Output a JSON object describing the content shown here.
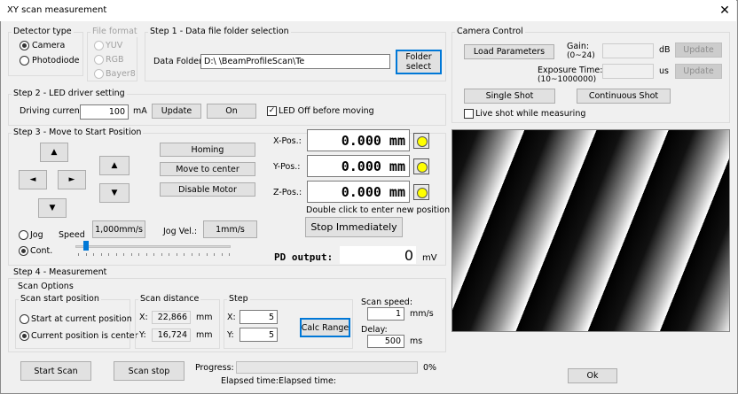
{
  "window": {
    "title": "XY scan measurement",
    "close": "✕"
  },
  "detector": {
    "label": "Detector type",
    "camera": "Camera",
    "photodiode": "Photodiode"
  },
  "file_format": {
    "label": "File format",
    "yuv": "YUV",
    "rgb": "RGB",
    "bayer8": "Bayer8"
  },
  "step1": {
    "label": "Step 1 - Data file folder selection",
    "folder_label": "Data Folder:",
    "folder_value": "D:\\                                 \\BeamProfileScan\\Te",
    "folder_select_1": "Folder",
    "folder_select_2": "select"
  },
  "camera": {
    "label": "Camera Control",
    "load_params": "Load Parameters",
    "gain_label": "Gain:",
    "gain_range": "(0~24)",
    "gain_unit": "dB",
    "update1": "Update",
    "exposure_label": "Exposure Time:",
    "exposure_range": "(10~1000000)",
    "exposure_unit": "us",
    "update2": "Update",
    "single_shot": "Single Shot",
    "continuous_shot": "Continuous Shot",
    "live_shot": "Live shot while measuring"
  },
  "step2": {
    "label": "Step 2 - LED driver setting",
    "driving_label": "Driving current:",
    "driving_value": "100",
    "driving_unit": "mA",
    "update": "Update",
    "on": "On",
    "led_off": "LED Off before moving",
    "led_off_checked": true
  },
  "step3": {
    "label": "Step 3 - Move to Start Position",
    "homing": "Homing",
    "move_center": "Move to center",
    "disable_motor": "Disable Motor",
    "jog": "Jog",
    "cont": "Cont.",
    "speed_label": "Speed",
    "speed_value": "1,000mm/s",
    "jog_vel_label": "Jog Vel.:",
    "jog_vel_value": "1mm/s",
    "speed_slider_fraction": 0.05
  },
  "positions": {
    "x_label": "X-Pos.:",
    "x_value": "0.000 mm",
    "y_label": "Y-Pos.:",
    "y_value": "0.000 mm",
    "z_label": "Z-Pos.:",
    "z_value": "0.000 mm",
    "hint": "Double click to enter new position",
    "stop": "Stop Immediately",
    "pd_label": "PD output:",
    "pd_value": "0",
    "pd_unit": "mV"
  },
  "step4": {
    "label": "Step 4 - Measurement",
    "scan_options": "Scan Options",
    "start_pos_label": "Scan start position",
    "start_current": "Start at current position",
    "current_center": "Current position is center",
    "distance_label": "Scan distance",
    "dx_label": "X:",
    "dx_value": "22,866",
    "dx_unit": "mm",
    "dy_label": "Y:",
    "dy_value": "16,724",
    "dy_unit": "mm",
    "step_label": "Step",
    "sx_label": "X:",
    "sx_value": "5",
    "sy_label": "Y:",
    "sy_value": "5",
    "calc_range": "Calc Range",
    "speed_label": "Scan speed:",
    "speed_value": "1",
    "speed_unit": "mm/s",
    "delay_label": "Delay:",
    "delay_value": "500",
    "delay_unit": "ms"
  },
  "bottom": {
    "start_scan": "Start Scan",
    "scan_stop": "Scan stop",
    "progress_label": "Progress:",
    "progress_pct": "0%",
    "progress_fraction": 0,
    "elapsed1": "Elapsed time:",
    "elapsed2": "Elapsed time:",
    "ok": "Ok"
  },
  "colors": {
    "accent": "#0078d7",
    "led": "#ffff00"
  }
}
